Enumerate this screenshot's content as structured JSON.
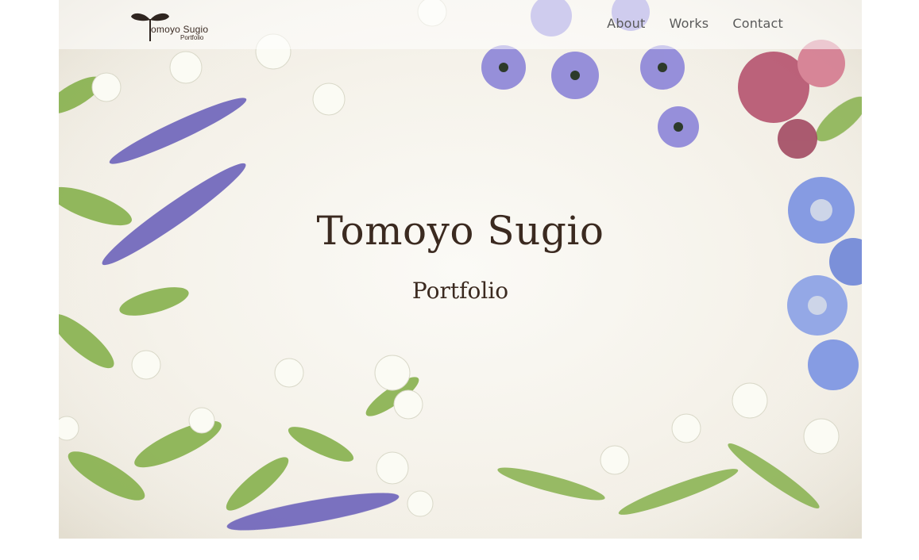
{
  "header": {
    "logo_name": "omoyo Sugio",
    "logo_sub": "Portfolio",
    "nav": [
      {
        "label": "About"
      },
      {
        "label": "Works"
      },
      {
        "label": "Contact"
      }
    ]
  },
  "hero": {
    "title": "Tomoyo Sugio",
    "subtitle": "Portfolio"
  },
  "colors": {
    "text_brown": "#3b2a20",
    "nav_gray": "#5a5a5a",
    "paper": "#f5f2ea",
    "lavender": "#6a62b8",
    "blue_flower": "#7b8fe0",
    "pink_flower": "#b04a68",
    "leaf_green": "#7aa84a"
  }
}
